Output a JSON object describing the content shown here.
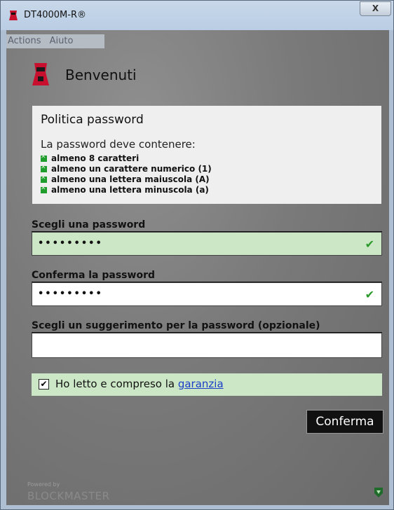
{
  "window": {
    "title": "DT4000M-R®",
    "close_label": "X"
  },
  "menu": {
    "items": [
      "Actions",
      "Aiuto"
    ]
  },
  "header": {
    "title": "Benvenuti"
  },
  "policy": {
    "title": "Politica password",
    "intro": "La password deve contenere:",
    "requirements": [
      "almeno 8 caratteri",
      "almeno un carattere numerico (1)",
      "almeno una lettera maiuscola (A)",
      "almeno una lettera minuscola (a)"
    ]
  },
  "fields": {
    "password": {
      "label": "Scegli una password",
      "value": "•••••••••",
      "check": "✔"
    },
    "confirm": {
      "label": "Conferma la password",
      "value": "•••••••••",
      "check": "✔"
    },
    "hint": {
      "label": "Scegli un suggerimento per la password (opzionale)",
      "value": ""
    }
  },
  "terms": {
    "text": "Ho letto e compreso la ",
    "link": "garanzia",
    "checked": "✔"
  },
  "actions": {
    "confirm_label": "Conferma"
  },
  "footer": {
    "powered_by": "Powered by",
    "brand": "BLOCKMASTER"
  },
  "colors": {
    "accent_green": "#cce7c6",
    "brand_red": "#c8102e",
    "link": "#1a3ec8"
  }
}
